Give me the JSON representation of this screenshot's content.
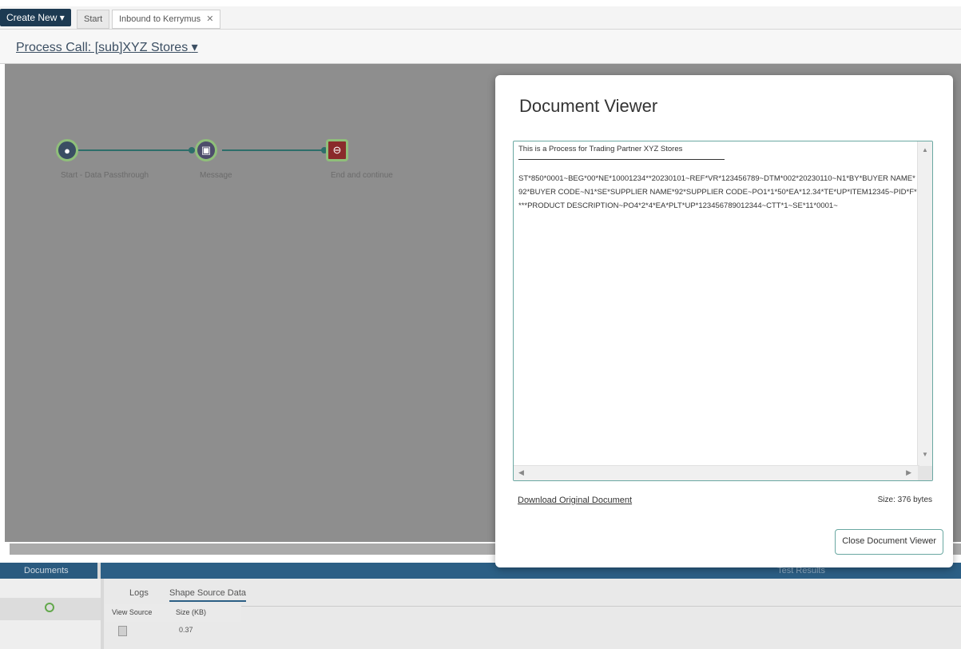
{
  "topbar": {
    "create_new": "Create New ▾",
    "tabs": [
      {
        "label": "Start"
      },
      {
        "label": "Inbound to Kerrymus",
        "close": "✕"
      }
    ]
  },
  "process": {
    "title": "Process Call: [sub]XYZ Stores",
    "caret": "▾"
  },
  "canvas": {
    "shapes": [
      {
        "icon": "play-icon",
        "label": "Start - Data Passthrough"
      },
      {
        "icon": "message-icon",
        "label": "Message"
      },
      {
        "icon": "stop-icon",
        "label": "End and continue"
      }
    ]
  },
  "bottom": {
    "documents_label": "Documents",
    "test_results_label": "Test Results",
    "tabs": [
      {
        "label": "Logs"
      },
      {
        "label": "Shape Source Data"
      }
    ],
    "grid_headers": [
      "View Source",
      "Size (KB)"
    ],
    "grid_rows": [
      {
        "size": "0.37"
      }
    ]
  },
  "modal": {
    "title": "Document Viewer",
    "description": "This is a Process for Trading Partner XYZ Stores",
    "content": "ST*850*0001~BEG*00*NE*10001234**20230101~REF*VR*123456789~DTM*002*20230110~N1*BY*BUYER NAME*92*BUYER CODE~N1*SE*SUPPLIER NAME*92*SUPPLIER CODE~PO1*1*50*EA*12.34*TE*UP*ITEM12345~PID*F****PRODUCT DESCRIPTION~PO4*2*4*EA*PLT*UP*123456789012344~CTT*1~SE*11*0001~",
    "download_link": "Download Original Document",
    "size_text": "Size: 376 bytes",
    "close_button": "Close Document Viewer"
  },
  "colors": {
    "header_dark": "#1d3a52",
    "panel_header": "#2c5f85",
    "canvas_bg": "#8e8e8e",
    "accent_teal": "#6aa8a2"
  }
}
